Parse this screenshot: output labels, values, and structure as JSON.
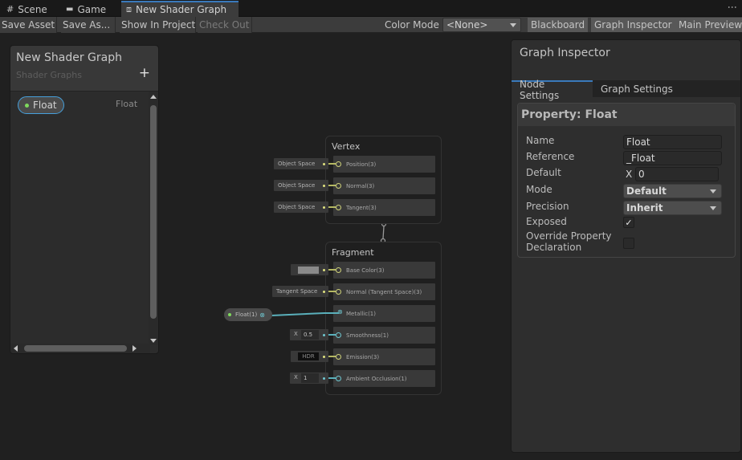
{
  "window_tabs": [
    {
      "label": "Scene",
      "icon": "grid-icon",
      "glyph": "#"
    },
    {
      "label": "Game",
      "icon": "gamepad-icon",
      "glyph": "🎮"
    },
    {
      "label": "New Shader Graph",
      "icon": "shader-graph-icon",
      "glyph": "⧈",
      "active": true
    }
  ],
  "toolbar": {
    "save_asset": "Save Asset",
    "save_as": "Save As...",
    "show_in_project": "Show In Project",
    "check_out": "Check Out",
    "color_mode_label": "Color Mode",
    "color_mode_value": "<None>",
    "blackboard": "Blackboard",
    "graph_inspector": "Graph Inspector",
    "main_preview": "Main Preview",
    "more_glyph": "⋮"
  },
  "blackboard": {
    "title": "New Shader Graph",
    "subtitle": "Shader Graphs",
    "add_glyph": "+",
    "properties": [
      {
        "name": "Float",
        "type": "Float"
      }
    ]
  },
  "graph": {
    "vertex": {
      "title": "Vertex",
      "slots": [
        {
          "label": "Position(3)",
          "input": "Object Space"
        },
        {
          "label": "Normal(3)",
          "input": "Object Space"
        },
        {
          "label": "Tangent(3)",
          "input": "Object Space"
        }
      ]
    },
    "fragment": {
      "title": "Fragment",
      "slots": [
        {
          "label": "Base Color(3)",
          "input": "color-swatch",
          "color": "#8a8a8a"
        },
        {
          "label": "Normal (Tangent Space)(3)",
          "input": "Tangent Space"
        },
        {
          "label": "Metallic(1)",
          "input": "connected"
        },
        {
          "label": "Smoothness(1)",
          "input_x": "X",
          "input_value": "0.5"
        },
        {
          "label": "Emission(3)",
          "input": "HDR"
        },
        {
          "label": "Ambient Occlusion(1)",
          "input_x": "X",
          "input_value": "1"
        }
      ]
    },
    "property_node": {
      "label": "Float(1)"
    }
  },
  "inspector": {
    "title": "Graph Inspector",
    "tabs": [
      {
        "label": "Node Settings",
        "active": true
      },
      {
        "label": "Graph Settings",
        "active": false
      }
    ],
    "property_title": "Property: Float",
    "fields": {
      "name_label": "Name",
      "name_value": "Float",
      "reference_label": "Reference",
      "reference_value": "_Float",
      "default_label": "Default",
      "default_x": "X",
      "default_value": "0",
      "mode_label": "Mode",
      "mode_value": "Default",
      "precision_label": "Precision",
      "precision_value": "Inherit",
      "exposed_label": "Exposed",
      "exposed_checked": true,
      "check_glyph": "✓",
      "override_label_1": "Override Property",
      "override_label_2": "Declaration",
      "override_checked": false
    }
  },
  "colors": {
    "accent": "#3a79bb",
    "selection": "#46a0dc",
    "vector_port": "#cfd27a",
    "float_port": "#6fc7d0",
    "property_dot": "#7fd95d"
  }
}
